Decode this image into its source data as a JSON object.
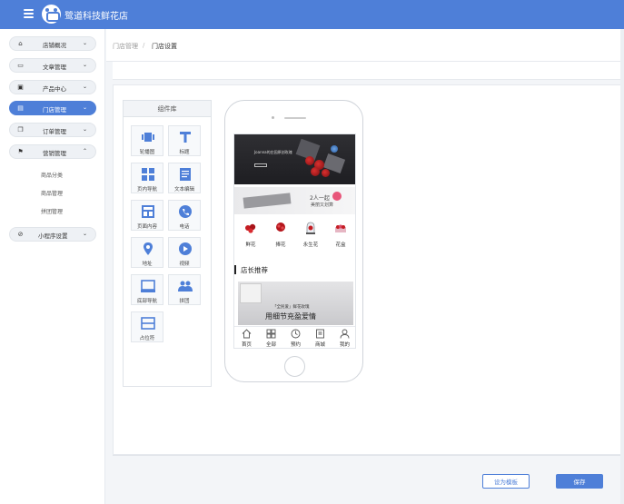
{
  "app": {
    "title": "鹭道科技鲜花店"
  },
  "sidebar": {
    "items": [
      {
        "label": "店铺概况",
        "icon": "home-icon"
      },
      {
        "label": "文章管理",
        "icon": "article-icon"
      },
      {
        "label": "产品中心",
        "icon": "product-icon"
      },
      {
        "label": "门店管理",
        "icon": "store-icon"
      },
      {
        "label": "订单管理",
        "icon": "order-icon"
      },
      {
        "label": "营销管理",
        "icon": "marketing-icon"
      },
      {
        "label": "小程序设置",
        "icon": "settings-icon"
      }
    ],
    "subitems": [
      "商品分类",
      "商品管理",
      "拼团管理"
    ]
  },
  "breadcrumb": {
    "parent": "门店管理",
    "separator": "/",
    "current": "门店设置"
  },
  "library": {
    "title": "组件库",
    "components": [
      {
        "label": "轮播图",
        "icon": "carousel-icon"
      },
      {
        "label": "标题",
        "icon": "title-icon"
      },
      {
        "label": "页内导航",
        "icon": "grid-nav-icon"
      },
      {
        "label": "文本编辑",
        "icon": "text-edit-icon"
      },
      {
        "label": "页面内容",
        "icon": "page-content-icon"
      },
      {
        "label": "电话",
        "icon": "phone-icon"
      },
      {
        "label": "地址",
        "icon": "location-icon"
      },
      {
        "label": "视频",
        "icon": "video-icon"
      },
      {
        "label": "底部导航",
        "icon": "bottom-nav-icon"
      },
      {
        "label": "拼团",
        "icon": "group-buy-icon"
      },
      {
        "label": "占位符",
        "icon": "placeholder-icon"
      }
    ]
  },
  "preview": {
    "banner1_text": "Joanna的庄园原创玫瑰",
    "banner2_line1": "2人一起",
    "banner2_line2": "美丽又划算",
    "categories": [
      "鲜花",
      "捧花",
      "永生花",
      "花盒"
    ],
    "section_title": "店长推荐",
    "promo_line1": "「全民爱」鲜花玫瑰",
    "promo_line2": "用细节充盈爱情",
    "tabs": [
      {
        "label": "首页",
        "icon": "home-tab-icon"
      },
      {
        "label": "全部",
        "icon": "all-tab-icon"
      },
      {
        "label": "预约",
        "icon": "booking-tab-icon"
      },
      {
        "label": "商城",
        "icon": "shop-tab-icon"
      },
      {
        "label": "我的",
        "icon": "profile-tab-icon"
      }
    ]
  },
  "actions": {
    "template_label": "设为模板",
    "save_label": "保存"
  },
  "colors": {
    "accent": "#4e7fd8",
    "background": "#f3f5f8"
  }
}
